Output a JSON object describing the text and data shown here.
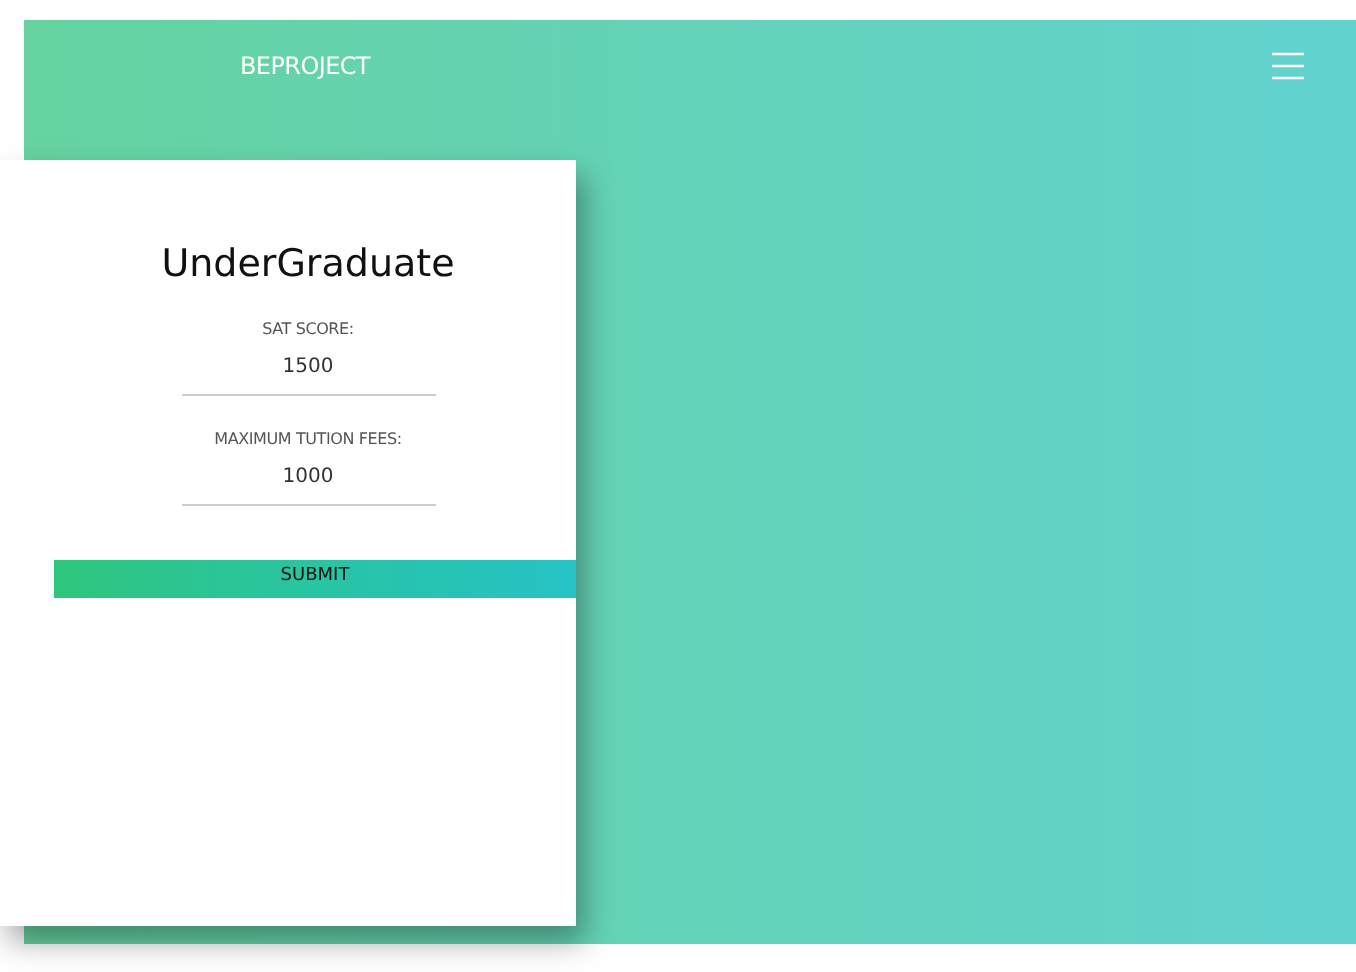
{
  "navbar": {
    "brand": "BEPROJECT"
  },
  "form": {
    "title": "UnderGraduate",
    "fields": [
      {
        "label": "SAT SCORE:",
        "value": "1500"
      },
      {
        "label": "MAXIMUM TUTION FEES:",
        "value": "1000"
      }
    ],
    "submit": "SUBMIT"
  }
}
